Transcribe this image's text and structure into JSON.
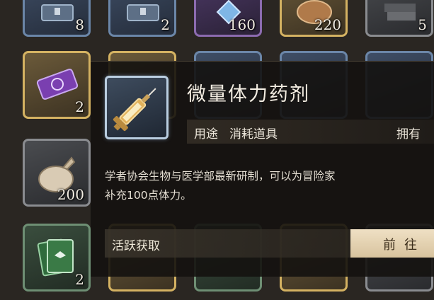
{
  "inventory": {
    "slots": [
      {
        "count": "8",
        "rarity": "blue",
        "icon": "chest-icon"
      },
      {
        "count": "2",
        "rarity": "blue",
        "icon": "chest-icon"
      },
      {
        "count": "160",
        "rarity": "purple",
        "icon": "crystal-icon"
      },
      {
        "count": "220",
        "rarity": "gold",
        "icon": "coin-icon"
      },
      {
        "count": "5",
        "rarity": "gray",
        "icon": "ore-icon"
      },
      {
        "count": "2",
        "rarity": "gold",
        "icon": "ticket-icon"
      },
      {
        "count": "200",
        "rarity": "gray",
        "icon": "pouch-icon"
      },
      {
        "count": "2",
        "rarity": "green",
        "icon": "card-pack-icon"
      }
    ]
  },
  "item_detail": {
    "title": "微量体力药剂",
    "usage_label": "用途",
    "usage_value": "消耗道具",
    "owned_label": "拥有",
    "description_line1": "学者协会生物与医学部最新研制，可以为冒险家",
    "description_line2": "补充100点体力。",
    "source_label": "活跃获取",
    "goto_button": "前往",
    "icon": "syringe-icon"
  }
}
